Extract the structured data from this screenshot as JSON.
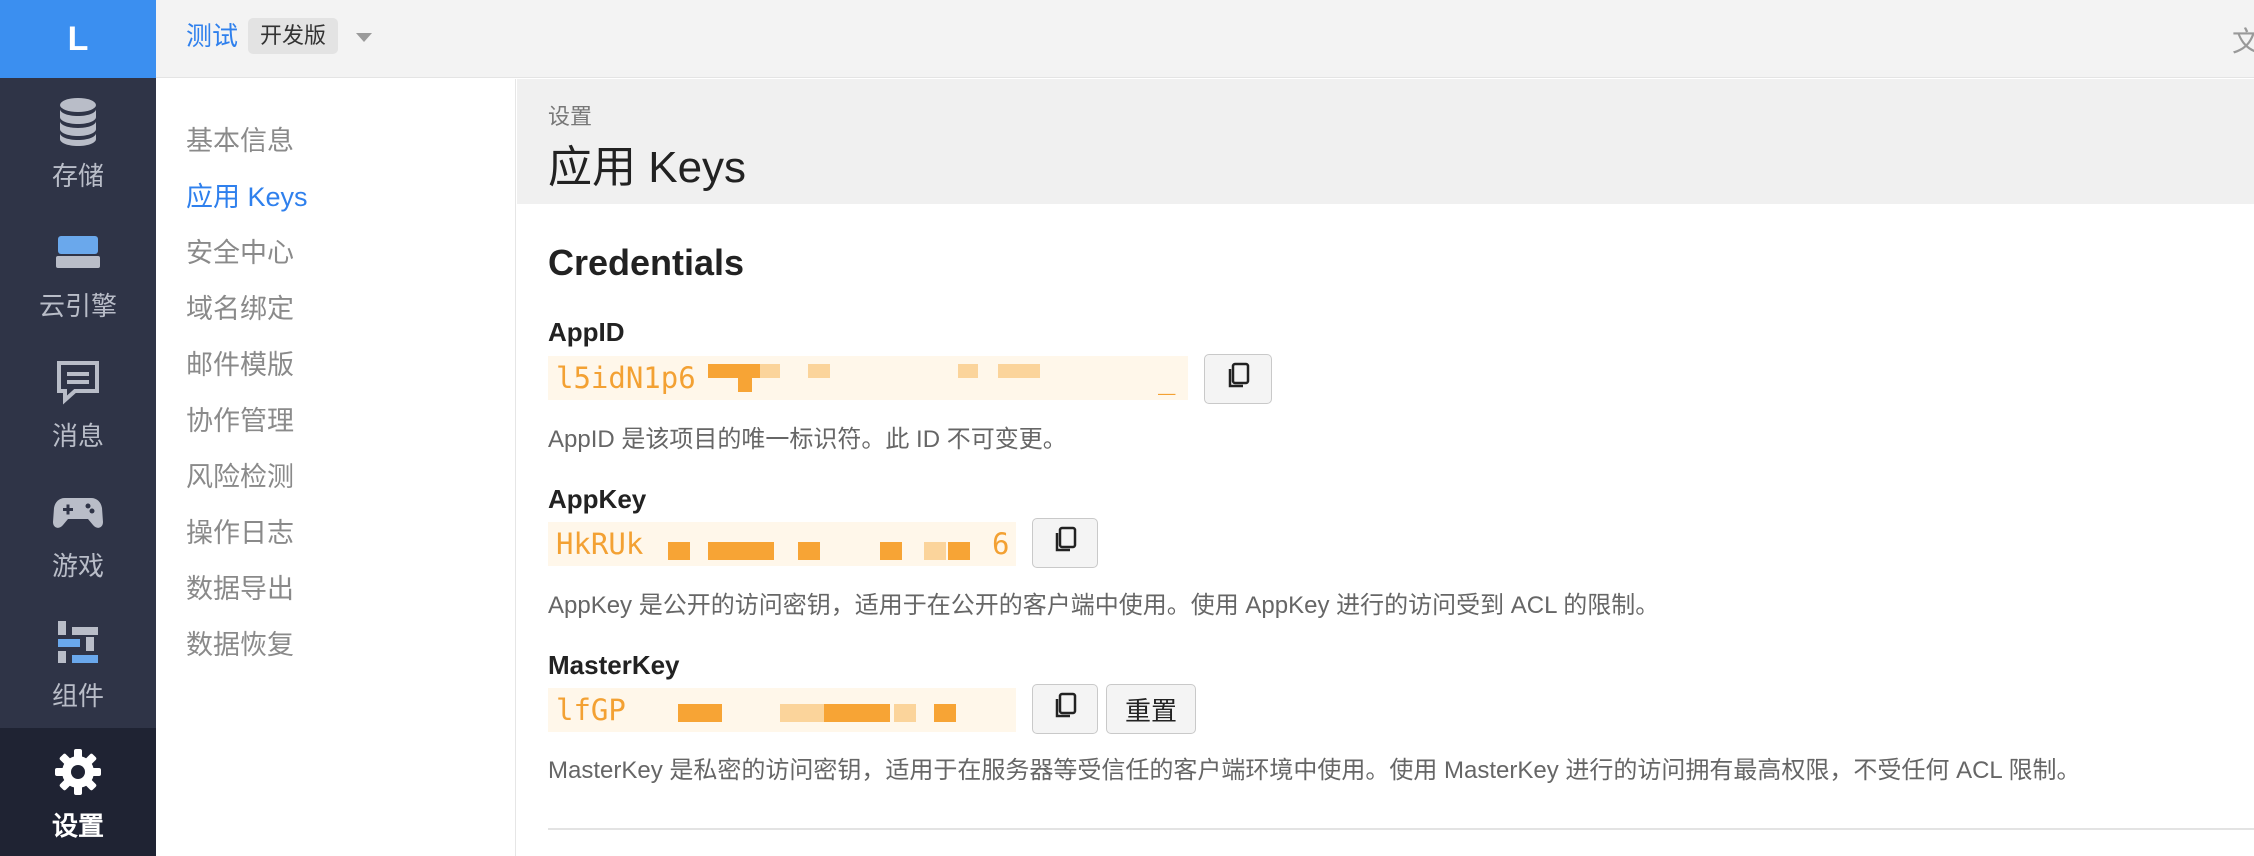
{
  "logo": "L",
  "rail": [
    {
      "label": "存储",
      "icon": "database-icon"
    },
    {
      "label": "云引擎",
      "icon": "server-icon"
    },
    {
      "label": "消息",
      "icon": "message-icon"
    },
    {
      "label": "游戏",
      "icon": "gamepad-icon"
    },
    {
      "label": "组件",
      "icon": "components-icon"
    },
    {
      "label": "设置",
      "icon": "gear-icon",
      "active": true
    }
  ],
  "topbar": {
    "app_name": "测试",
    "env": "开发版",
    "right_char": "文"
  },
  "subnav": [
    {
      "label": "基本信息"
    },
    {
      "label": "应用 Keys",
      "active": true
    },
    {
      "label": "安全中心"
    },
    {
      "label": "域名绑定"
    },
    {
      "label": "邮件模版"
    },
    {
      "label": "协作管理"
    },
    {
      "label": "风险检测"
    },
    {
      "label": "操作日志"
    },
    {
      "label": "数据导出"
    },
    {
      "label": "数据恢复"
    }
  ],
  "header": {
    "breadcrumb": "设置",
    "title": "应用 Keys"
  },
  "credentials": {
    "title": "Credentials",
    "appid": {
      "label": "AppID",
      "value_visible": "l5idN1p6",
      "tail": "_",
      "desc": "AppID 是该项目的唯一标识符。此 ID 不可变更。"
    },
    "appkey": {
      "label": "AppKey",
      "value_visible": "HkRUk",
      "tail": "6",
      "desc": "AppKey 是公开的访问密钥，适用于在公开的客户端中使用。使用 AppKey 进行的访问受到 ACL 的限制。"
    },
    "masterkey": {
      "label": "MasterKey",
      "value_visible": "lfGP",
      "tail": "",
      "reset_label": "重置",
      "desc": "MasterKey 是私密的访问密钥，适用于在服务器等受信任的客户端环境中使用。使用 MasterKey 进行的访问拥有最高权限，不受任何 ACL 限制。"
    }
  },
  "colors": {
    "accent": "#2f80ed",
    "logo_bg": "#3b8ff0",
    "rail_bg": "#2f3447",
    "key_text": "#f3a133",
    "key_bg": "#fff7ea"
  }
}
